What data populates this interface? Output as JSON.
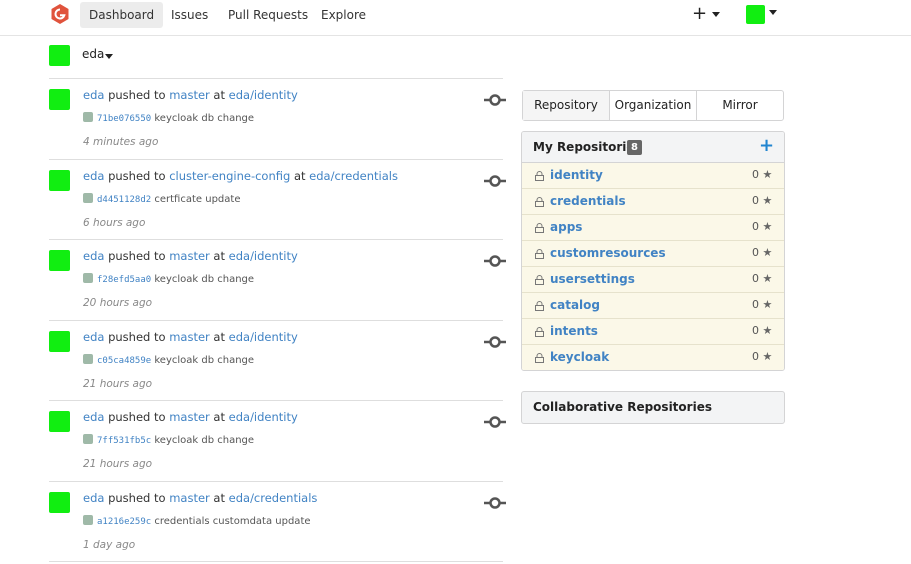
{
  "nav": {
    "items": [
      {
        "label": "Dashboard",
        "active": true
      },
      {
        "label": "Issues",
        "active": false
      },
      {
        "label": "Pull Requests",
        "active": false
      },
      {
        "label": "Explore",
        "active": false
      }
    ],
    "create_label": "+"
  },
  "context": {
    "user": "eda"
  },
  "feed": [
    {
      "actor": "eda",
      "verb": "pushed to",
      "branch": "master",
      "at": "at",
      "repo": "eda/identity",
      "sha": "71be076550",
      "message": "keycloak db change",
      "time": "4 minutes ago"
    },
    {
      "actor": "eda",
      "verb": "pushed to",
      "branch": "cluster-engine-config",
      "at": "at",
      "repo": "eda/credentials",
      "sha": "d4451128d2",
      "message": "certficate update",
      "time": "6 hours ago"
    },
    {
      "actor": "eda",
      "verb": "pushed to",
      "branch": "master",
      "at": "at",
      "repo": "eda/identity",
      "sha": "f28efd5aa0",
      "message": "keycloak db change",
      "time": "20 hours ago"
    },
    {
      "actor": "eda",
      "verb": "pushed to",
      "branch": "master",
      "at": "at",
      "repo": "eda/identity",
      "sha": "c05ca4859e",
      "message": "keycloak db change",
      "time": "21 hours ago"
    },
    {
      "actor": "eda",
      "verb": "pushed to",
      "branch": "master",
      "at": "at",
      "repo": "eda/identity",
      "sha": "7ff531fb5c",
      "message": "keycloak db change",
      "time": "21 hours ago"
    },
    {
      "actor": "eda",
      "verb": "pushed to",
      "branch": "master",
      "at": "at",
      "repo": "eda/credentials",
      "sha": "a1216e259c",
      "message": "credentials customdata update",
      "time": "1 day ago"
    }
  ],
  "tabs": [
    {
      "label": "Repository",
      "active": true
    },
    {
      "label": "Organization",
      "active": false
    },
    {
      "label": "Mirror",
      "active": false
    }
  ],
  "my_repos": {
    "title": "My Repositories",
    "count": "8",
    "add_label": "+",
    "items": [
      {
        "name": "identity",
        "stars": "0"
      },
      {
        "name": "credentials",
        "stars": "0"
      },
      {
        "name": "apps",
        "stars": "0"
      },
      {
        "name": "customresources",
        "stars": "0"
      },
      {
        "name": "usersettings",
        "stars": "0"
      },
      {
        "name": "catalog",
        "stars": "0"
      },
      {
        "name": "intents",
        "stars": "0"
      },
      {
        "name": "keycloak",
        "stars": "0"
      }
    ]
  },
  "collab": {
    "title": "Collaborative Repositories"
  },
  "colors": {
    "accent": "#4183c4",
    "avatar": "#11ee11",
    "logo": "#e0533c",
    "repo_row_bg": "#fbf8e8"
  }
}
